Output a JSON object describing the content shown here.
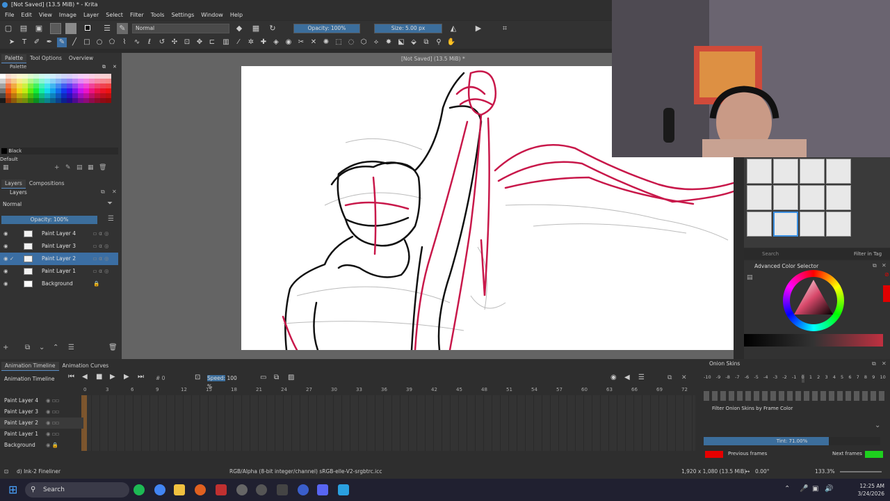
{
  "window": {
    "title": "[Not Saved] (13.5 MiB) * - Krita"
  },
  "menu": [
    "File",
    "Edit",
    "View",
    "Image",
    "Layer",
    "Select",
    "Filter",
    "Tools",
    "Settings",
    "Window",
    "Help"
  ],
  "toolbar": {
    "blend_mode": "Normal",
    "opacity": "Opacity: 100%",
    "size": "Size: 5.00 px"
  },
  "left_top_tabs": [
    "Palette",
    "Tool Options",
    "Overview"
  ],
  "palette": {
    "current_color_name": "Black",
    "palette_name": "Default"
  },
  "layers_tabs": [
    "Layers",
    "Compositions"
  ],
  "layers": {
    "panel_title": "Layers",
    "blend": "Normal",
    "opacity": "Opacity:  100%",
    "items": [
      "Paint Layer 4",
      "Paint Layer 3",
      "Paint Layer 2",
      "Paint Layer 1",
      "Background"
    ]
  },
  "canvas_title": "[Not Saved]  (13.5 MiB) *",
  "brushes": {
    "search_placeholder": "Search",
    "filter_label": "Filter in Tag"
  },
  "color_selector": {
    "title": "Advanced Color Selector"
  },
  "timeline": {
    "tabs": [
      "Animation Timeline",
      "Animation Curves"
    ],
    "title": "Animation Timeline",
    "frame": "0",
    "speed_label": "Speed:",
    "speed_value": "100 %",
    "ruler": [
      "0",
      "3",
      "6",
      "9",
      "12",
      "15",
      "18",
      "21",
      "24",
      "27",
      "30",
      "33",
      "36",
      "39",
      "42",
      "45",
      "48",
      "51",
      "54",
      "57",
      "60",
      "63",
      "66",
      "69",
      "72"
    ],
    "layers": [
      "Paint Layer 4",
      "Paint Layer 3",
      "Paint Layer 2",
      "Paint Layer 1",
      "Background"
    ]
  },
  "onion": {
    "title": "Onion Skins",
    "numbers": [
      "-10",
      "-9",
      "-8",
      "-7",
      "-6",
      "-5",
      "-4",
      "-3",
      "-2",
      "-1",
      "0",
      "1",
      "2",
      "3",
      "4",
      "5",
      "6",
      "7",
      "8",
      "9",
      "10"
    ],
    "filter_label": "Filter Onion Skins by Frame Color",
    "tint": "Tint: 71.00%",
    "previous": "Previous frames",
    "next": "Next frames",
    "previous_color": "#e60000",
    "next_color": "#1ed01e"
  },
  "status": {
    "brush": "d) Ink-2 Fineliner",
    "colorspace": "RGB/Alpha (8-bit integer/channel)  sRGB-elle-V2-srgbtrc.icc",
    "dimensions": "1,920 x 1,080 (13.5 MiB)",
    "rotation": "0.00°",
    "zoom": "133.3%"
  },
  "taskbar": {
    "search": "Search",
    "time": "12:25 AM",
    "date": "3/24/2026"
  },
  "colors": {
    "accent": "#3b6ea3",
    "ink_red": "#cc1f4a"
  }
}
